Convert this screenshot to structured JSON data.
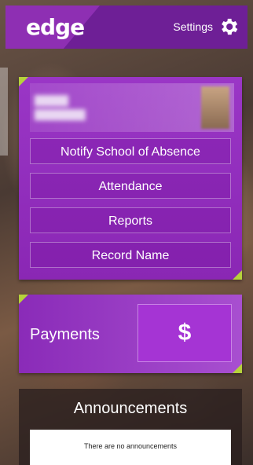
{
  "header": {
    "logo": "edge",
    "settings_label": "Settings",
    "settings_icon": "gear-icon"
  },
  "student_card": {
    "menu_items": [
      "Notify School of Absence",
      "Attendance",
      "Reports",
      "Record Name"
    ]
  },
  "payments": {
    "label": "Payments",
    "icon_symbol": "$"
  },
  "announcements": {
    "title": "Announcements",
    "empty_text": "There are no announcements"
  },
  "colors": {
    "brand_purple": "#8e2fb3",
    "accent_green": "#b6d23b"
  }
}
